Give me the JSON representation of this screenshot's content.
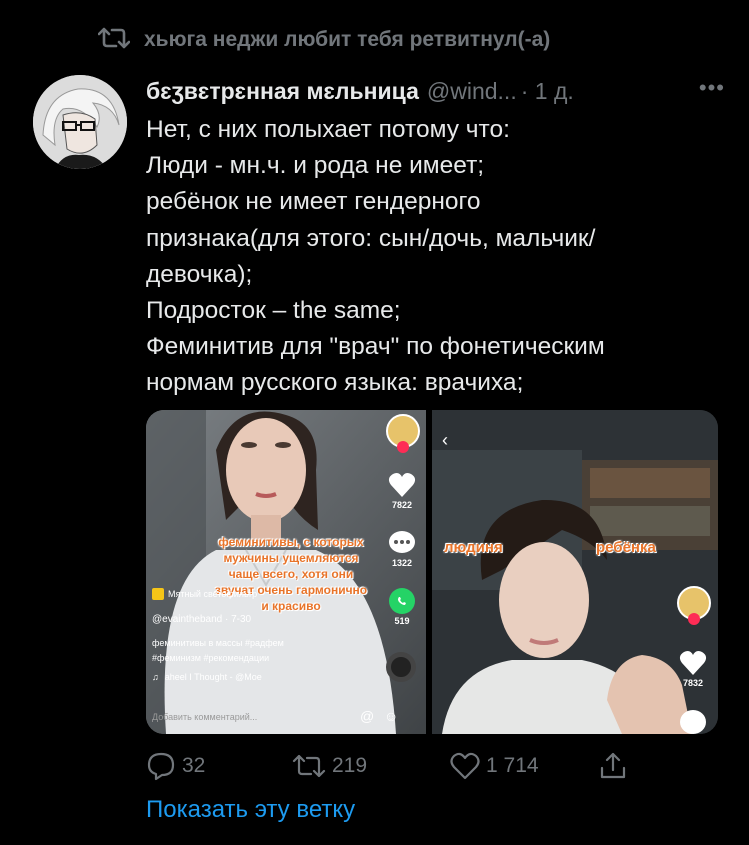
{
  "retweet": {
    "text": "хьюга неджи любит тебя ретвитнул(-а)",
    "icon": "retweet-icon"
  },
  "tweet": {
    "author_name": "бɛʒвɛтрɛнная мɛльница",
    "handle": "@wind...",
    "time": "· 1 д.",
    "more": "•••",
    "lines": [
      "Нет, с них полыхает потому что:",
      "Люди - мн.ч. и рода не имеет;",
      "ребёнок не имеет гендерного",
      "признака(для этого: сын/дочь, мальчик/",
      "девочка);",
      "Подросток – the same;",
      "Феминитив для \"врач\" по фонетическим",
      "нормам русского языка: врачиха;"
    ]
  },
  "media": {
    "left": {
      "caption_lines": [
        "феминитивы, с которых",
        "мужчины ущемляются",
        "чаще всего, хотя они",
        "звучат очень гармонично",
        "и красиво"
      ],
      "likes": "7822",
      "comments": "1322",
      "shares": "519",
      "filter_label": "Мятный светофильтр",
      "username": "@evaintheband · 7-30",
      "description_1": "феминитивы в массы #радфем",
      "description_2": "#феминизм #рекомендации",
      "music": "aheel   I Thought - @Moe",
      "comment_placeholder": "Добавить комментарий..."
    },
    "right": {
      "label_left": "людиня",
      "label_right": "ребёнка",
      "likes": "7832"
    }
  },
  "actions": {
    "replies": "32",
    "retweets": "219",
    "likes": "1 714"
  },
  "thread_link": "Показать эту ветку",
  "colors": {
    "background": "#000000",
    "text": "#e7e9ea",
    "muted": "#71767b",
    "accent": "#1d9bf0",
    "caption": "#e8742a"
  }
}
